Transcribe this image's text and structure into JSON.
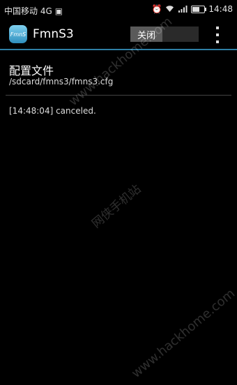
{
  "status_bar": {
    "carrier": "中国移动 4G",
    "time": "14:48",
    "signal_label": "4G",
    "battery_fraction": 0.6
  },
  "action_bar": {
    "app_icon_text": "FmnS",
    "title": "FmnS3",
    "toggle_label": "关闭",
    "overflow_icon": "overflow-menu-icon"
  },
  "content": {
    "config_label": "配置文件",
    "config_path": "/sdcard/fmns3/fmns3.cfg",
    "log": "[14:48:04] canceled."
  },
  "watermarks": [
    "www.hackhome.com",
    "网侠手机站",
    "www.hackhome.com"
  ],
  "colors": {
    "background": "#000000",
    "accent_line": "#2e7fa5",
    "toggle_knob": "#5a5a5a"
  }
}
